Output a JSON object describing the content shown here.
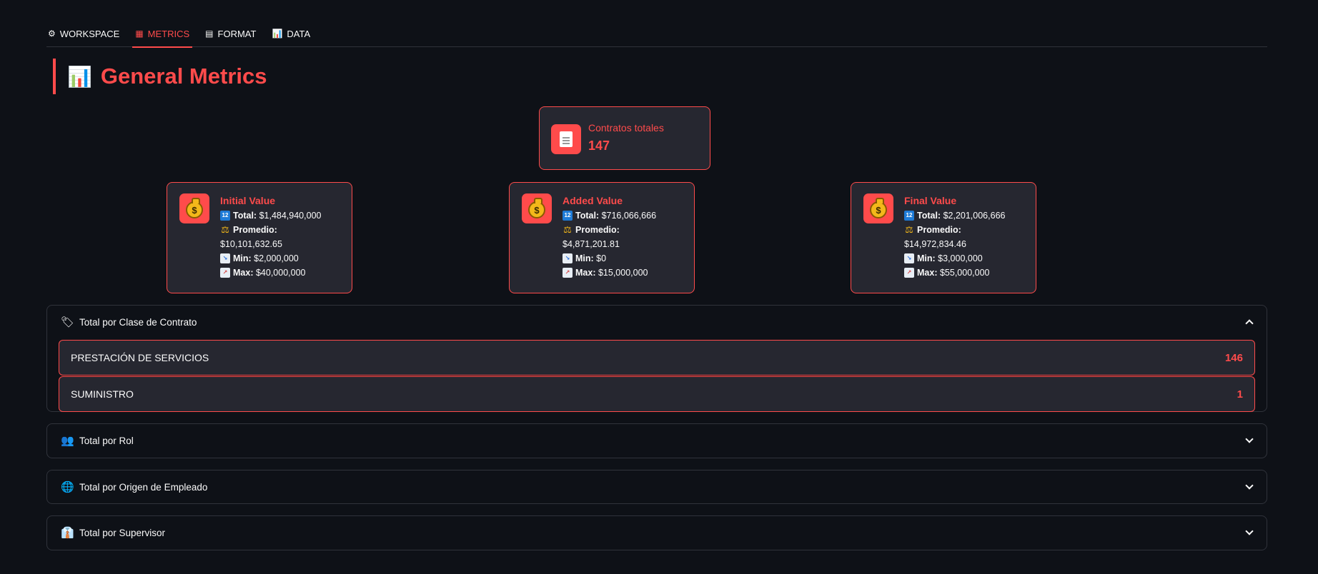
{
  "tabs": [
    {
      "icon": "⚙",
      "label": "WORKSPACE",
      "active": false
    },
    {
      "icon": "▦",
      "label": "METRICS",
      "active": true
    },
    {
      "icon": "▤",
      "label": "FORMAT",
      "active": false
    },
    {
      "icon": "📊",
      "label": "DATA",
      "active": false
    }
  ],
  "header": {
    "icon": "📊",
    "title": "General Metrics"
  },
  "total_card": {
    "label": "Contratos totales",
    "value": "147",
    "icon": "document-icon"
  },
  "stats": [
    {
      "name": "Initial Value",
      "total_label": "Total:",
      "total": "$1,484,940,000",
      "avg_label": "Promedio:",
      "avg": "$10,101,632.65",
      "min_label": "Min:",
      "min": "$2,000,000",
      "max_label": "Max:",
      "max": "$40,000,000"
    },
    {
      "name": "Added Value",
      "total_label": "Total:",
      "total": "$716,066,666",
      "avg_label": "Promedio:",
      "avg": "$4,871,201.81",
      "min_label": "Min:",
      "min": "$0",
      "max_label": "Max:",
      "max": "$15,000,000"
    },
    {
      "name": "Final Value",
      "total_label": "Total:",
      "total": "$2,201,006,666",
      "avg_label": "Promedio:",
      "avg": "$14,972,834.46",
      "min_label": "Min:",
      "min": "$3,000,000",
      "max_label": "Max:",
      "max": "$55,000,000"
    }
  ],
  "expanders": [
    {
      "icon": "🏷",
      "label": "Total por Clase de Contrato",
      "expanded": true
    },
    {
      "icon": "👥",
      "label": "Total por Rol",
      "expanded": false
    },
    {
      "icon": "🌐",
      "label": "Total por Origen de Empleado",
      "expanded": false
    },
    {
      "icon": "👔",
      "label": "Total por Supervisor",
      "expanded": false
    }
  ],
  "classes": [
    {
      "name": "PRESTACIÓN DE SERVICIOS",
      "count": "146"
    },
    {
      "name": "SUMINISTRO",
      "count": "1"
    }
  ],
  "colors": {
    "accent": "#ff4b4b",
    "background": "#0e1117",
    "card": "#262730"
  }
}
